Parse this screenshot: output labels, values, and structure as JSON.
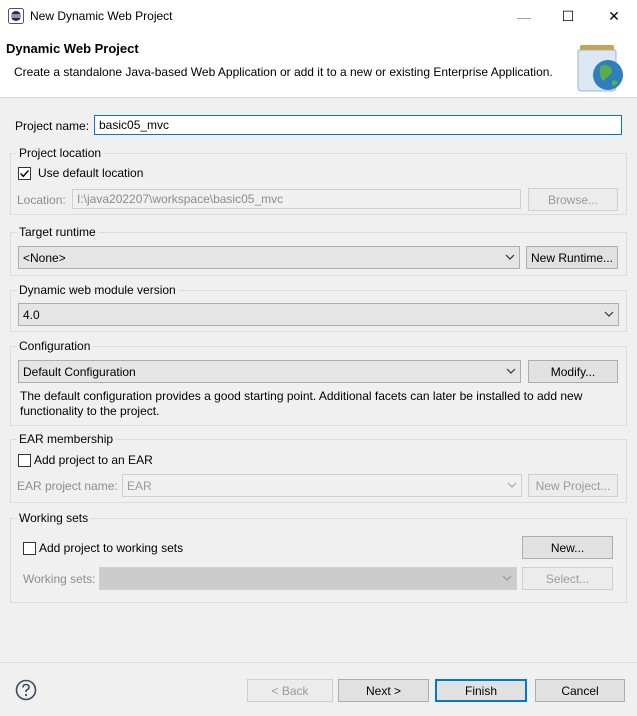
{
  "window": {
    "title": "New Dynamic Web Project",
    "minimize_glyph": "—",
    "maximize_glyph": "☐",
    "close_glyph": "✕"
  },
  "header": {
    "title": "Dynamic Web Project",
    "description": "Create a standalone Java-based Web Application or add it to a new or existing Enterprise Application."
  },
  "project_name": {
    "label": "Project name:",
    "value": "basic05_mvc"
  },
  "project_location": {
    "group_label": "Project location",
    "use_default_label": "Use default location",
    "use_default_checked": true,
    "location_label": "Location:",
    "location_value": "I:\\java202207\\workspace\\basic05_mvc",
    "browse_label": "Browse..."
  },
  "target_runtime": {
    "group_label": "Target runtime",
    "selected": "<None>",
    "new_runtime_label": "New Runtime..."
  },
  "module_version": {
    "group_label": "Dynamic web module version",
    "selected": "4.0"
  },
  "configuration": {
    "group_label": "Configuration",
    "selected": "Default Configuration",
    "modify_label": "Modify...",
    "description_line1": "The default configuration provides a good starting point. Additional facets can later be installed to add new",
    "description_line2": "functionality to the project."
  },
  "ear_membership": {
    "group_label": "EAR membership",
    "add_label": "Add project to an EAR",
    "add_checked": false,
    "ear_project_name_label": "EAR project name:",
    "ear_project_value": "EAR",
    "new_project_label": "New Project..."
  },
  "working_sets": {
    "group_label": "Working sets",
    "add_label": "Add project to working sets",
    "add_checked": false,
    "new_label": "New...",
    "working_sets_label": "Working sets:",
    "working_sets_value": "",
    "select_label": "Select..."
  },
  "footer": {
    "back_label": "< Back",
    "next_label": "Next >",
    "finish_label": "Finish",
    "cancel_label": "Cancel"
  },
  "colors": {
    "focus_blue": "#0078d7",
    "dialog_bg": "#f0f0f0"
  },
  "icons": {
    "app": "eclipse-icon",
    "header_image": "jar-globe-icon",
    "help": "help-icon"
  }
}
